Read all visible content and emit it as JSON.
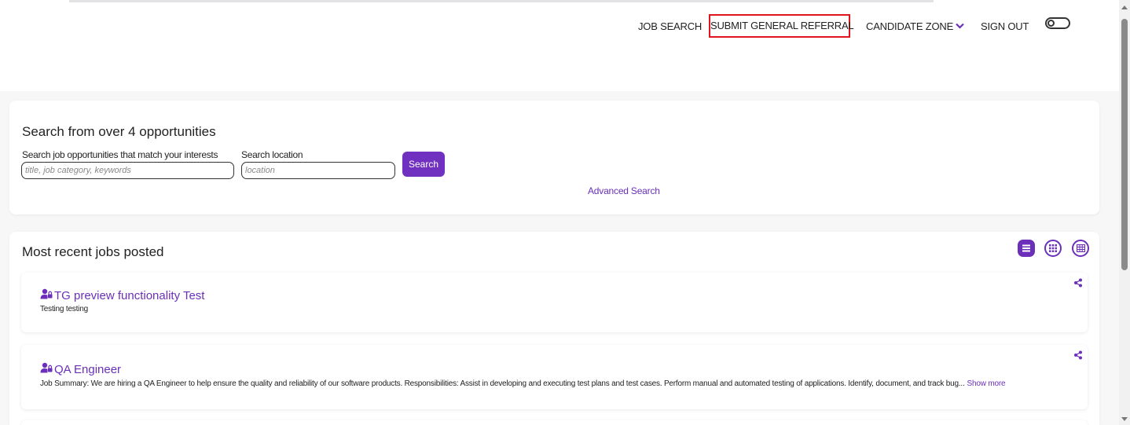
{
  "nav": {
    "job_search": "JOB SEARCH",
    "submit_referral": "SUBMIT GENERAL REFERRAL",
    "candidate_zone": "CANDIDATE ZONE",
    "sign_out": "SIGN OUT"
  },
  "search": {
    "title": "Search from over 4 opportunities",
    "keywords_label": "Search job opportunities that match your interests",
    "keywords_placeholder": "title, job category, keywords",
    "location_label": "Search location",
    "location_placeholder": "location",
    "button_label": "Search",
    "advanced_link": "Advanced Search"
  },
  "jobs": {
    "title": "Most recent jobs posted",
    "items": [
      {
        "title": "TG preview functionality Test",
        "description": "Testing testing"
      },
      {
        "title": "QA Engineer",
        "description": "Job Summary: We are hiring a QA Engineer to help ensure the quality and reliability of our software products. Responsibilities: Assist in developing and executing test plans and test cases. Perform manual and automated testing of applications. Identify, document, and track bug...",
        "show_more": "Show more"
      }
    ]
  },
  "colors": {
    "accent": "#6b2fba",
    "button": "#7030c0",
    "highlight_border": "#e0161e"
  },
  "icons": {
    "job_icon": "user-lock-icon",
    "share": "share-icon",
    "view_list": "list-view-icon",
    "view_grid": "grid-view-icon",
    "view_table": "table-view-icon",
    "theme_toggle": "toggle-icon"
  }
}
